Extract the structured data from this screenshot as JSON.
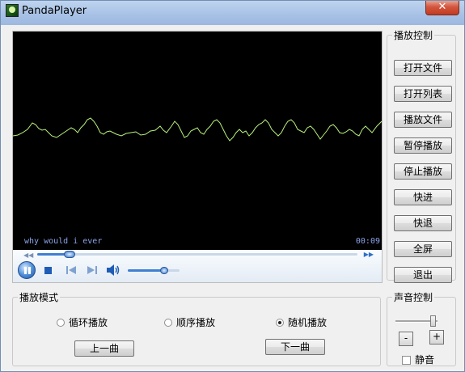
{
  "window": {
    "title": "PandaPlayer",
    "close_glyph": "✕"
  },
  "player": {
    "caption": "why would i ever",
    "time": "00:09",
    "seek_progress": 0.1,
    "volume_level": 0.7
  },
  "play_control": {
    "legend": "播放控制",
    "buttons": [
      "打开文件",
      "打开列表",
      "播放文件",
      "暂停播放",
      "停止播放",
      "快进",
      "快退",
      "全屏",
      "退出"
    ]
  },
  "play_mode": {
    "legend": "播放模式",
    "options": [
      "循环播放",
      "顺序播放",
      "随机播放"
    ],
    "selected_index": 2,
    "prev_label": "上一曲",
    "next_label": "下一曲"
  },
  "sound_control": {
    "legend": "声音控制",
    "minus_label": "-",
    "plus_label": "+",
    "mute_label": "静音",
    "mute_checked": false,
    "volume_level": 0.9
  },
  "colors": {
    "waveform": "#b9f27c",
    "caption_text": "#8aa3e8",
    "accent": "#3f7fd2"
  },
  "icons": [
    "app-icon",
    "close-icon",
    "pause-icon",
    "stop-icon",
    "previous-icon",
    "next-icon",
    "volume-icon",
    "rewind-icon",
    "fast-forward-icon"
  ]
}
